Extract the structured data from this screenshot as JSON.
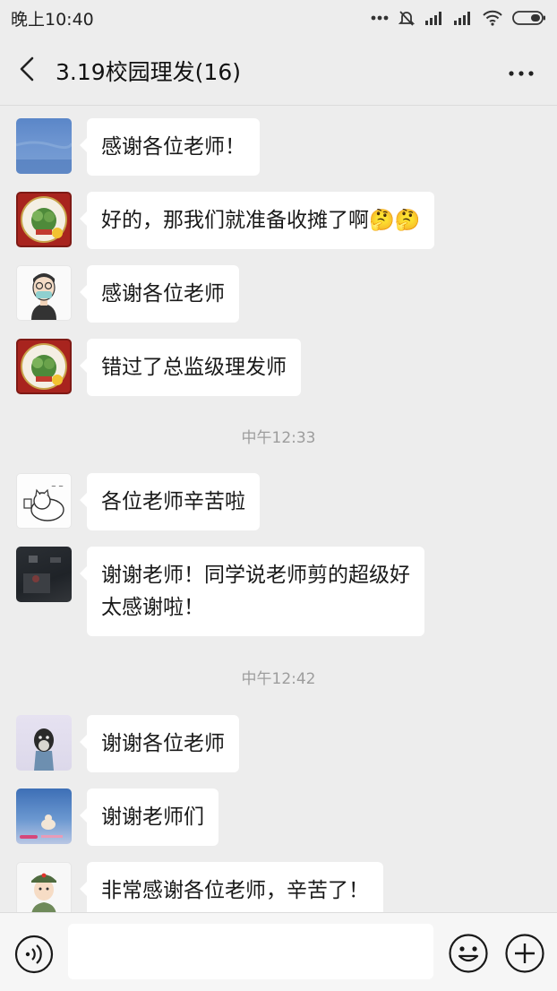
{
  "status_bar": {
    "time": "晚上10:40",
    "icons": [
      "dots-icon",
      "mute-bell-icon",
      "signal-1-icon",
      "signal-2-icon",
      "wifi-icon",
      "battery-icon"
    ]
  },
  "header": {
    "back_icon": "chevron-left-icon",
    "title": "3.19校园理发(16)",
    "more_icon": "more-dots-icon"
  },
  "messages": [
    {
      "type": "msg",
      "avatar": "sky-photo",
      "text": "感谢各位老师！"
    },
    {
      "type": "msg",
      "avatar": "school-badge",
      "text": "好的，那我们就准备收摊了啊🤔🤔"
    },
    {
      "type": "msg",
      "avatar": "masked-face",
      "text": "感谢各位老师"
    },
    {
      "type": "msg",
      "avatar": "school-badge",
      "text": "错过了总监级理发师"
    },
    {
      "type": "time",
      "text": "中午12:33"
    },
    {
      "type": "msg",
      "avatar": "cartoon-cat",
      "text": "各位老师辛苦啦"
    },
    {
      "type": "msg",
      "avatar": "dark-scene",
      "text": "谢谢老师！同学说老师剪的超级好\n太感谢啦！"
    },
    {
      "type": "time",
      "text": "中午12:42"
    },
    {
      "type": "msg",
      "avatar": "dog-photo",
      "text": "谢谢各位老师"
    },
    {
      "type": "msg",
      "avatar": "blue-photo",
      "text": "谢谢老师们"
    },
    {
      "type": "msg",
      "avatar": "soldier-cartoon",
      "text": "非常感谢各位老师，辛苦了！"
    }
  ],
  "input_bar": {
    "voice_icon": "voice-icon",
    "placeholder": "",
    "emoji_icon": "emoji-icon",
    "plus_icon": "plus-icon"
  },
  "colors": {
    "background": "#ededed",
    "bubble": "#ffffff",
    "timestamp": "#9d9d9d"
  }
}
